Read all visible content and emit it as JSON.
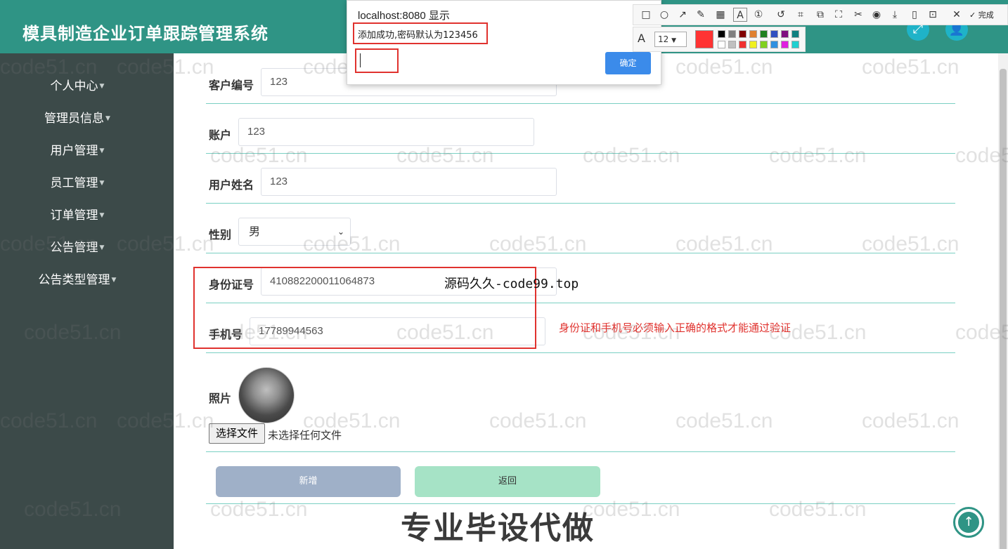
{
  "app": {
    "title": "模具制造企业订单跟踪管理系统"
  },
  "sidebar": {
    "items": [
      {
        "label": "个人中心"
      },
      {
        "label": "管理员信息"
      },
      {
        "label": "用户管理"
      },
      {
        "label": "员工管理"
      },
      {
        "label": "订单管理"
      },
      {
        "label": "公告管理"
      },
      {
        "label": "公告类型管理"
      }
    ]
  },
  "form": {
    "customer_no": {
      "label": "客户编号",
      "value": "123"
    },
    "account": {
      "label": "账户",
      "value": "123"
    },
    "user_name": {
      "label": "用户姓名",
      "value": "123"
    },
    "gender": {
      "label": "性别",
      "value": "男"
    },
    "id_card": {
      "label": "身份证号",
      "value": "410882200011064873"
    },
    "phone": {
      "label": "手机号",
      "value": "17789944563"
    },
    "photo": {
      "label": "照片",
      "file_button": "选择文件",
      "file_status": "未选择任何文件"
    },
    "add_button": "新增",
    "back_button": "返回"
  },
  "dialog": {
    "title": "localhost:8080 显示",
    "message": "添加成功,密码默认为123456",
    "ok": "确定"
  },
  "annotations": {
    "warning": "身份证和手机号必须输入正确的格式才能通过验证",
    "source_note": "源码久久-code99.top",
    "big_note": "专业毕设代做"
  },
  "watermark": {
    "text": "code51.cn"
  },
  "toolbar": {
    "done": "完成",
    "font_size": "12"
  },
  "colors": {
    "header": "#2f9485",
    "sidebar": "#3c4a49",
    "add_button": "#9fb0c8",
    "back_button": "#a6e3c6",
    "annotation_red": "#e0322e"
  }
}
